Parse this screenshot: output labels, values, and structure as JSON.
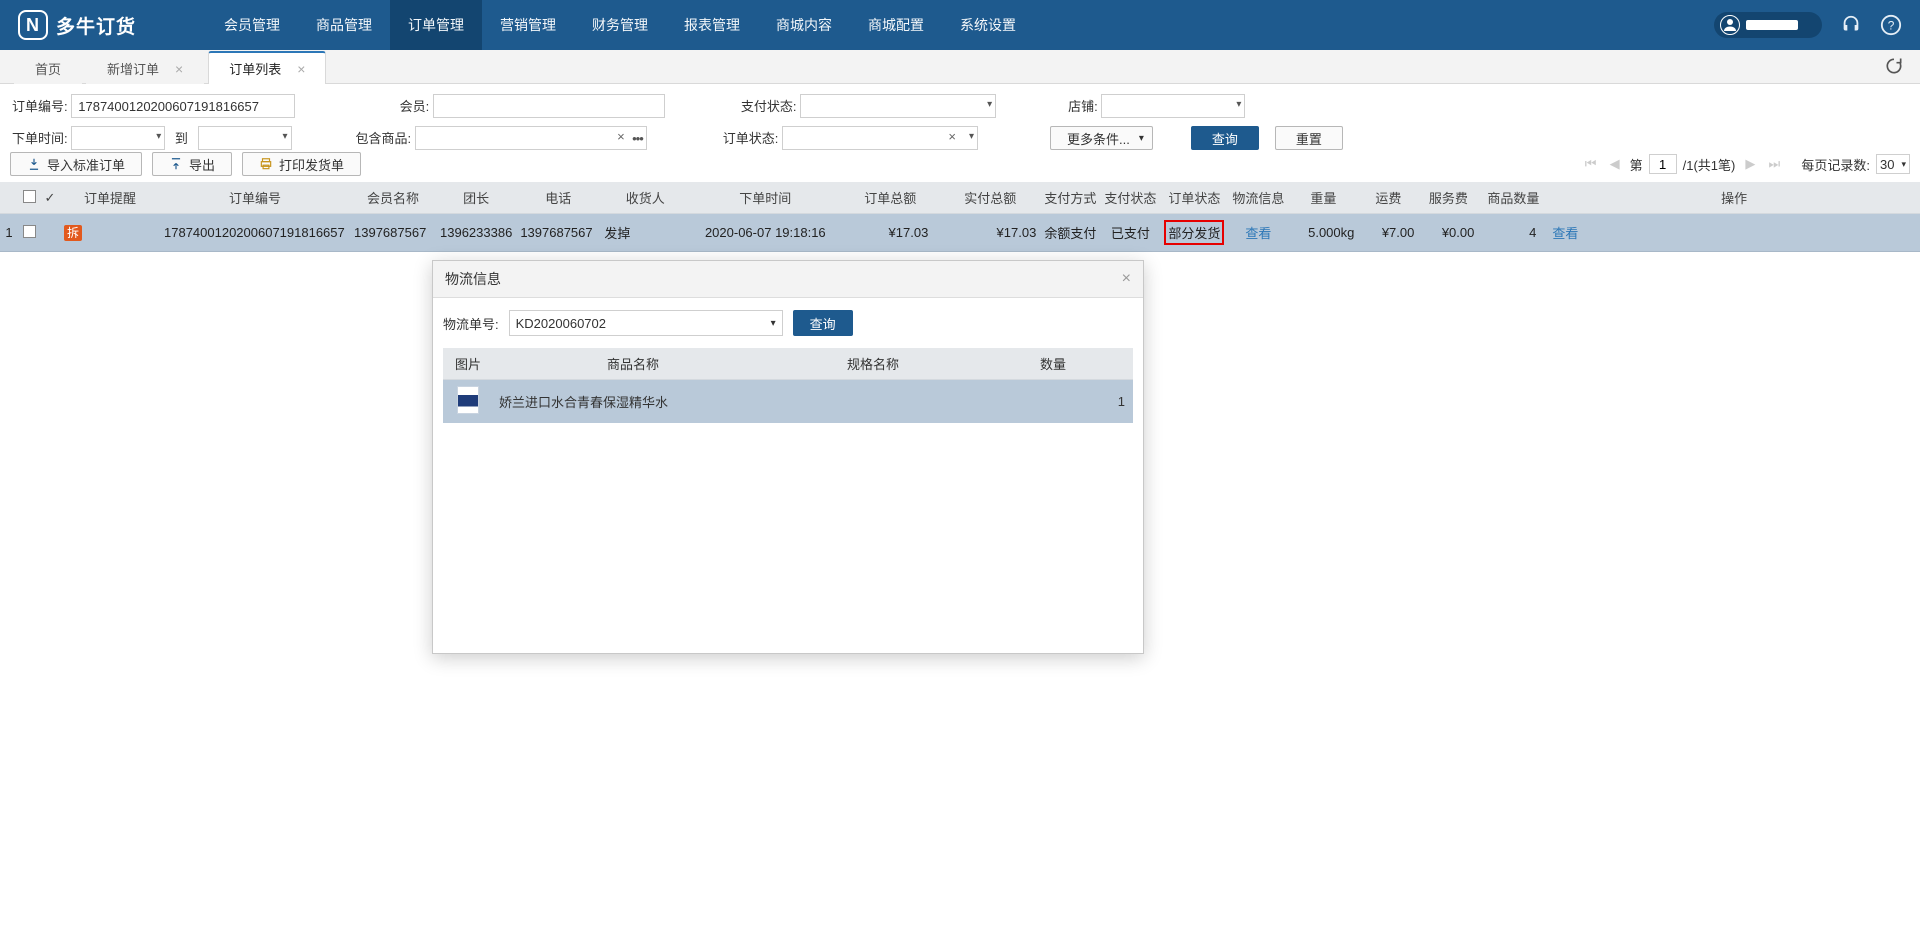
{
  "header": {
    "brand": "多牛订货",
    "nav": [
      "会员管理",
      "商品管理",
      "订单管理",
      "营销管理",
      "财务管理",
      "报表管理",
      "商城内容",
      "商城配置",
      "系统设置"
    ],
    "nav_active_index": 2
  },
  "tabs": [
    {
      "label": "首页",
      "closable": false
    },
    {
      "label": "新增订单",
      "closable": true
    },
    {
      "label": "订单列表",
      "closable": true
    }
  ],
  "tabs_active_index": 2,
  "filters": {
    "labels": {
      "order_no": "订单编号:",
      "member": "会员:",
      "pay_status": "支付状态:",
      "shop": "店铺:",
      "order_time": "下单时间:",
      "to": "到",
      "include_goods": "包含商品:",
      "order_status": "订单状态:",
      "more": "更多条件...",
      "query": "查询",
      "reset": "重置"
    },
    "values": {
      "order_no": "178740012020060719​1816657",
      "member": "",
      "pay_status": "",
      "shop": "",
      "time_from": "",
      "time_to": "",
      "include_goods": "",
      "order_status": ""
    }
  },
  "toolbar": {
    "import": "导入标准订单",
    "export": "导出",
    "print": "打印发货单"
  },
  "pager": {
    "page_label_prefix": "第",
    "page": "1",
    "total_text": "/1(共1笔)",
    "per_page_label": "每页记录数:",
    "per_page": "30"
  },
  "columns": [
    "",
    "",
    "",
    "订单提醒",
    "订单编号",
    "会员名称",
    "团长",
    "电话",
    "收货人",
    "下单时间",
    "订单总额",
    "实付总额",
    "支付方式",
    "支付状态",
    "订单状态",
    "物流信息",
    "重量",
    "运费",
    "服务费",
    "商品数量",
    "操作"
  ],
  "row": {
    "index": "1",
    "reminder_badge": "拆",
    "order_no": "178740012020060719​1816657",
    "member": "139768756​7",
    "leader": "139623338​6",
    "phone": "139768756​7",
    "receiver": "发掉",
    "time": "2020-06-07 19:18:16",
    "total": "¥17.03",
    "paid": "¥17.03",
    "pay_method": "余额支付",
    "pay_status": "已支付",
    "order_status": "部分发货",
    "logistics": "查看",
    "weight": "5.000kg",
    "ship_fee": "¥7.00",
    "service_fee": "¥0.00",
    "qty": "4",
    "op": "查看"
  },
  "modal": {
    "title": "物流信息",
    "tracking_label": "物流单号:",
    "tracking_value": "KD2020060702",
    "query": "查询",
    "columns": [
      "图片",
      "商品名称",
      "规格名称",
      "数量"
    ],
    "item": {
      "name": "娇兰进口水合青春保湿精华水",
      "spec": "",
      "qty": "1"
    }
  }
}
